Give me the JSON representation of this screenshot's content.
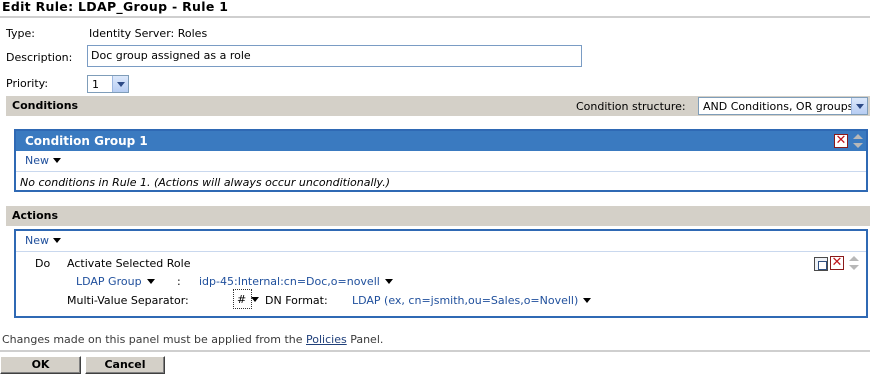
{
  "page": {
    "title": "Edit Rule: LDAP_Group - Rule 1"
  },
  "form": {
    "type_label": "Type:",
    "type_value": "Identity Server: Roles",
    "description_label": "Description:",
    "description_value": "Doc group assigned as a role",
    "priority_label": "Priority:",
    "priority_value": "1"
  },
  "conditions": {
    "section_title": "Conditions",
    "structure_label": "Condition structure:",
    "structure_value": "AND Conditions, OR groups",
    "group": {
      "title": "Condition Group 1",
      "new_label": "New",
      "empty_message": "No conditions in Rule 1. (Actions will always occur unconditionally.)"
    }
  },
  "actions": {
    "section_title": "Actions",
    "new_label": "New",
    "do_label": "Do",
    "action_name": "Activate Selected Role",
    "source_label": "LDAP Group",
    "colon": ":",
    "source_value": "idp-45:Internal:cn=Doc,o=novell",
    "separator_label": "Multi-Value Separator:",
    "separator_value": "#",
    "dn_format_label": "DN Format:",
    "dn_format_value": "LDAP (ex, cn=jsmith,ou=Sales,o=Novell)"
  },
  "footer": {
    "note_before": "Changes made on this panel must be applied from the ",
    "note_link": "Policies",
    "note_after": " Panel.",
    "ok_label": "OK",
    "cancel_label": "Cancel"
  },
  "icons": {
    "delete": "delete-icon",
    "move": "move-up-down-icon",
    "copy": "copy-icon",
    "dropdown": "chevron-down-icon"
  },
  "colors": {
    "group_header": "#3a7ac0",
    "group_border": "#2f69b4",
    "section_bar": "#d4d0c8",
    "link": "#1f4f9c"
  }
}
